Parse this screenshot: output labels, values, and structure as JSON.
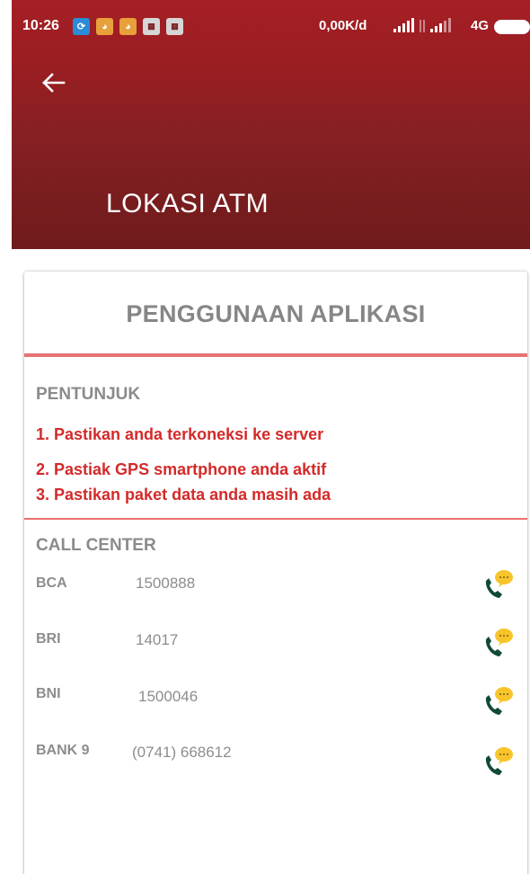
{
  "status_bar": {
    "time": "10:26",
    "speed": "0,00K/d",
    "network": "4G"
  },
  "app_bar": {
    "title": "LOKASI ATM",
    "back_icon": "arrow-left-icon"
  },
  "card": {
    "title": "PENGGUNAAN APLIKASI",
    "instructions": {
      "heading": "PENTUNJUK",
      "steps": [
        "1. Pastikan anda terkoneksi ke server",
        "2. Pastiak GPS smartphone anda aktif",
        "3. Pastikan paket data anda masih ada"
      ]
    },
    "call_center": {
      "heading": "CALL CENTER",
      "entries": [
        {
          "bank": "BCA",
          "number": "1500888"
        },
        {
          "bank": "BRI",
          "number": "14017"
        },
        {
          "bank": "BNI",
          "number": "1500046"
        },
        {
          "bank": "BANK 9",
          "number": "(0741) 668612"
        }
      ],
      "call_icon": "phone-chat-icon"
    }
  },
  "colors": {
    "appbar_top": "#a51f25",
    "appbar_bottom": "#6f1b1c",
    "accent_red": "#d42a2a",
    "divider": "#e57373",
    "muted_text": "#8b8b8b",
    "phone_green": "#0f4a3a",
    "bubble_yellow": "#f7c52b"
  }
}
